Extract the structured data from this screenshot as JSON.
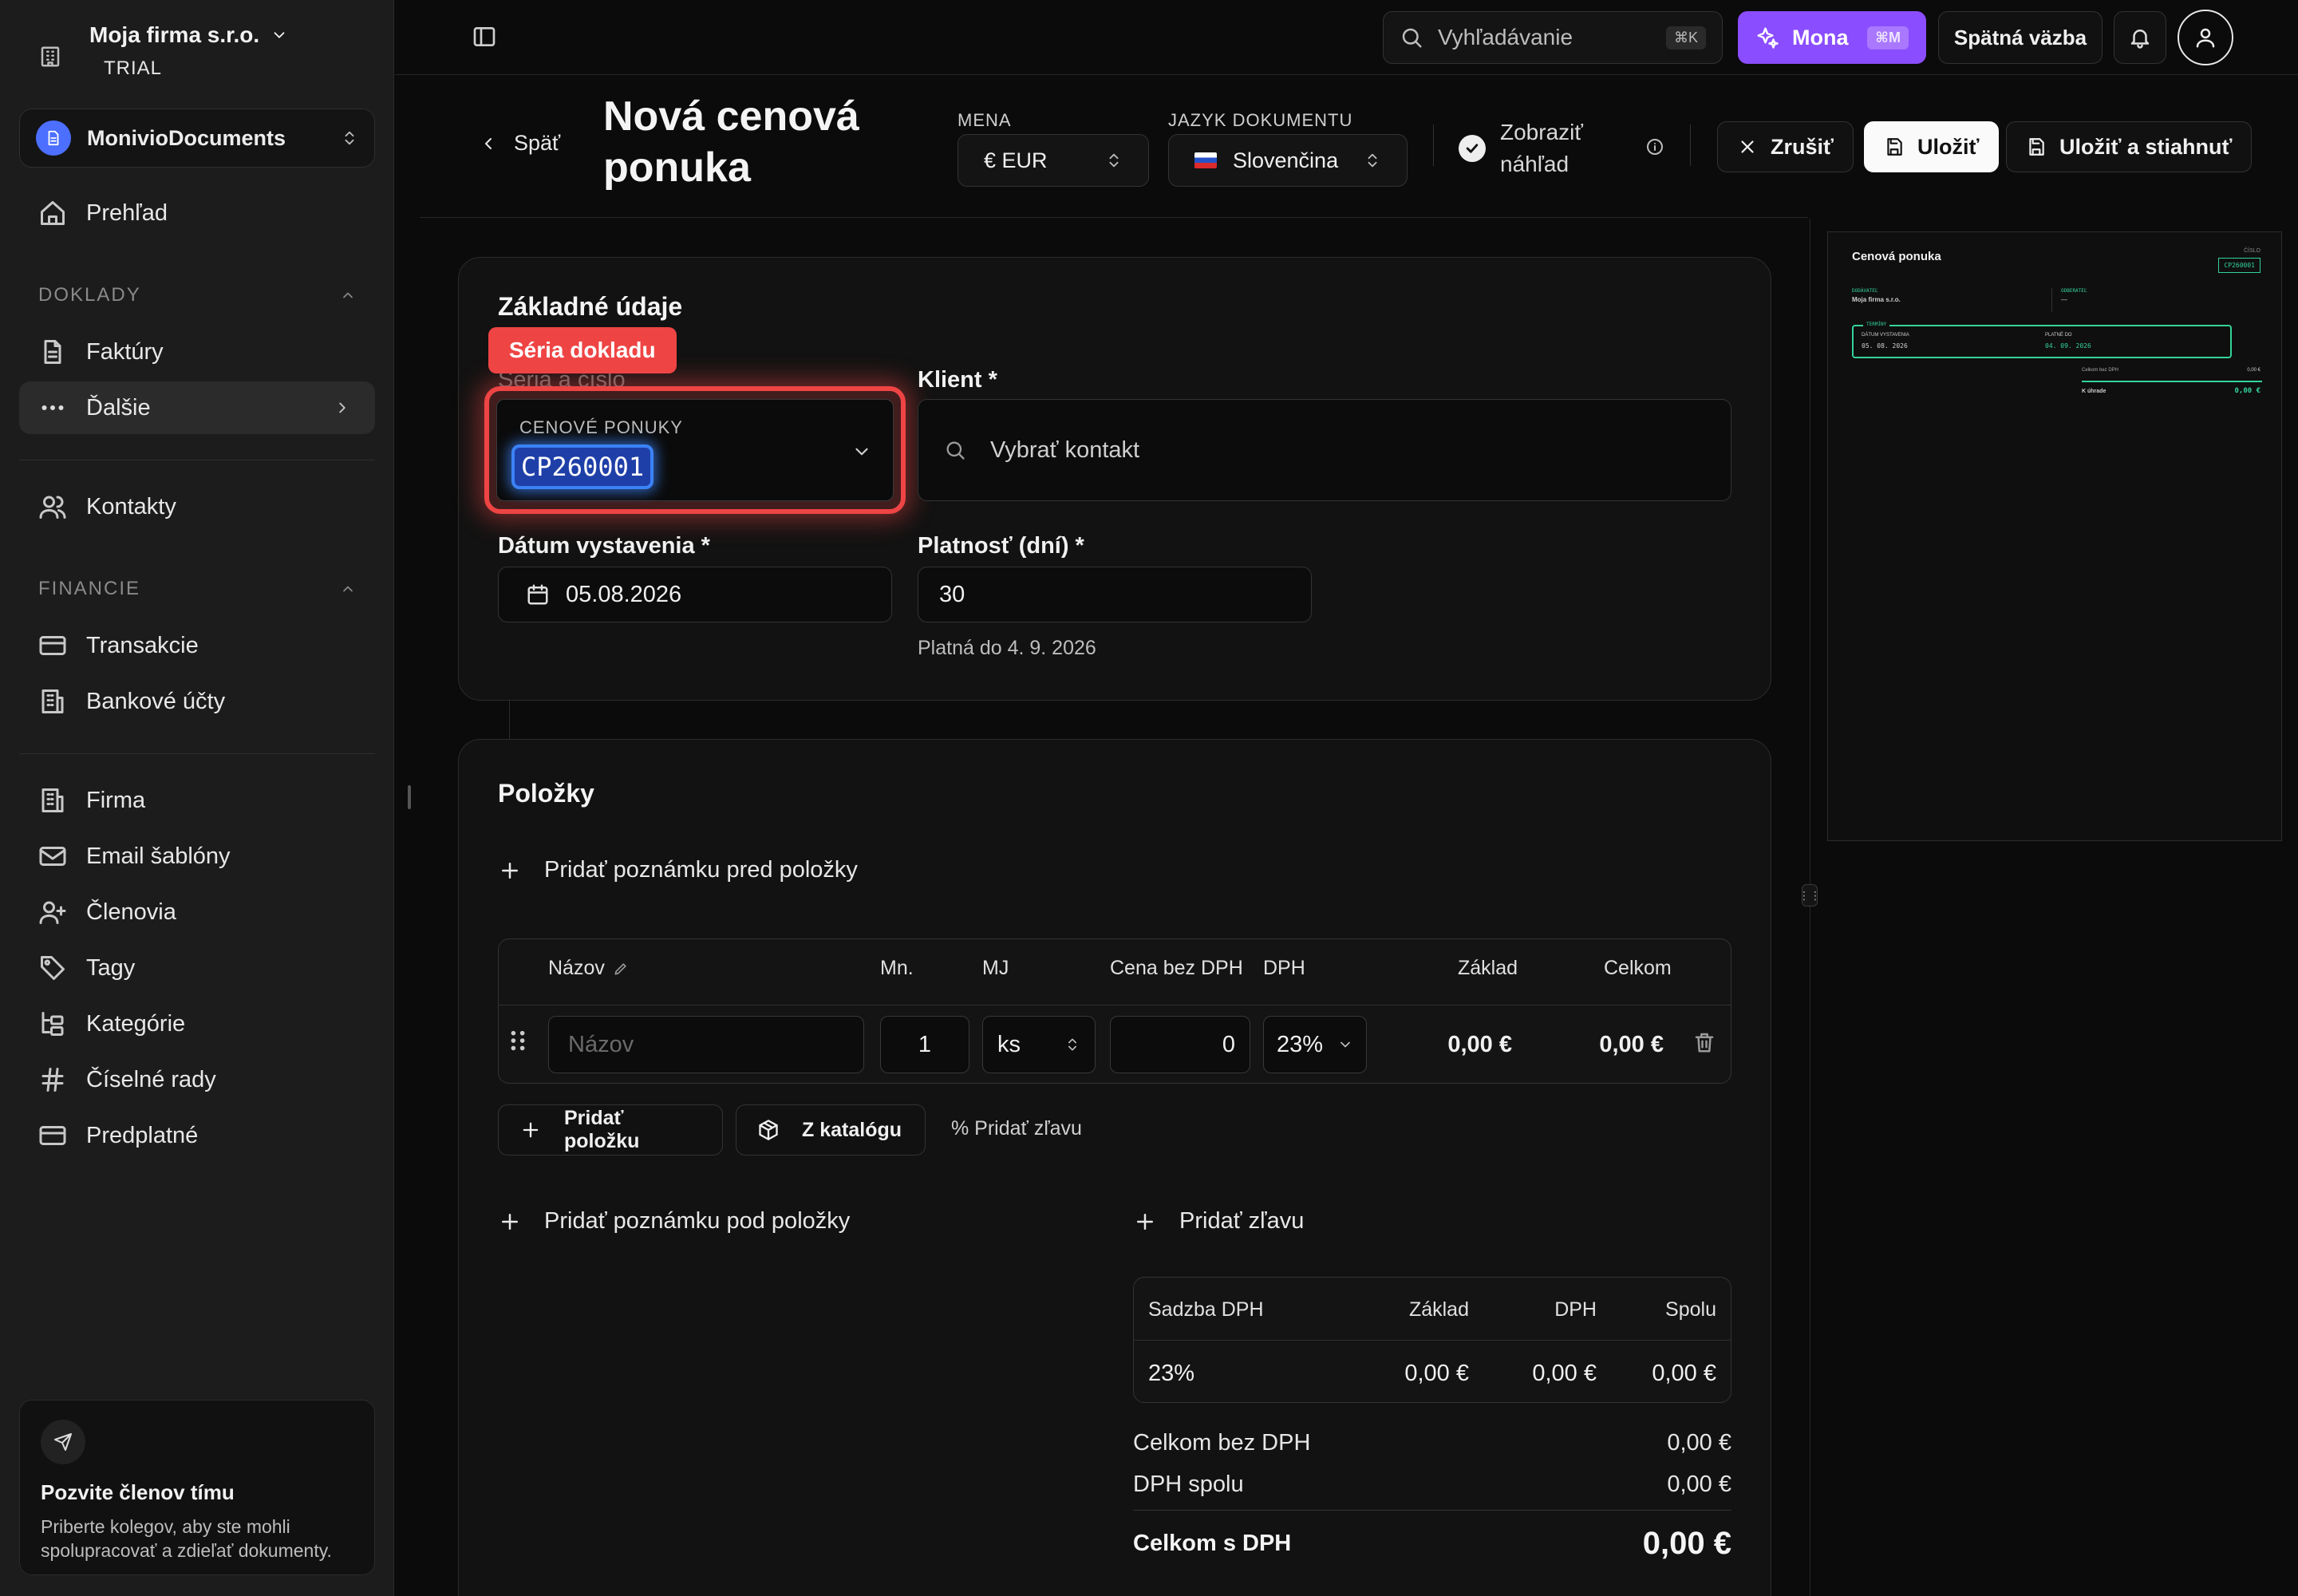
{
  "sidebar": {
    "org_name": "Moja firma s.r.o.",
    "org_plan": "TRIAL",
    "workspace": "MonivioDocuments",
    "nav_overview": "Prehľad",
    "section_doklady": "DOKLADY",
    "nav_invoices": "Faktúry",
    "nav_more": "Ďalšie",
    "nav_contacts": "Kontakty",
    "section_finance": "FINANCIE",
    "nav_transactions": "Transakcie",
    "nav_bank_accounts": "Bankové účty",
    "nav_company": "Firma",
    "nav_email_templates": "Email šablóny",
    "nav_members": "Členovia",
    "nav_tags": "Tagy",
    "nav_categories": "Kategórie",
    "nav_number_series": "Číselné rady",
    "nav_subscription": "Predplatné",
    "invite_title": "Pozvite členov tímu",
    "invite_text": "Priberte kolegov, aby ste mohli spolupracovať a zdieľať dokumenty."
  },
  "topbar": {
    "search_placeholder": "Vyhľadávanie",
    "search_shortcut": "⌘K",
    "mona_label": "Mona",
    "mona_shortcut": "⌘M",
    "feedback_label": "Spätná väzba"
  },
  "header": {
    "back_label": "Späť",
    "title": "Nová cenová ponuka",
    "currency_label": "MENA",
    "currency_value": "€ EUR",
    "language_label": "JAZYK DOKUMENTU",
    "language_value": "Slovenčina",
    "preview_label": "Zobraziť náhľad",
    "cancel_label": "Zrušiť",
    "save_label": "Uložiť",
    "save_download_label": "Uložiť a stiahnuť"
  },
  "basic": {
    "title": "Základné údaje",
    "highlight_tag": "Séria dokladu",
    "series_label": "Séria a číslo",
    "series_caption": "CENOVÉ PONUKY",
    "series_value": "CP260001",
    "client_label": "Klient *",
    "client_placeholder": "Vybrať kontakt",
    "issue_date_label": "Dátum vystavenia *",
    "issue_date_value": "05.08.2026",
    "validity_label": "Platnosť (dní) *",
    "validity_value": "30",
    "valid_until": "Platná do 4. 9. 2026"
  },
  "items": {
    "title": "Položky",
    "add_note_before": "Pridať poznámku pred položky",
    "columns": {
      "name": "Názov",
      "qty": "Mn.",
      "unit": "MJ",
      "price": "Cena bez DPH",
      "vat": "DPH",
      "base": "Základ",
      "total": "Celkom"
    },
    "row": {
      "name_placeholder": "Názov",
      "qty": "1",
      "unit": "ks",
      "price": "0",
      "vat": "23%",
      "base": "0,00 €",
      "total": "0,00 €"
    },
    "add_item": "Pridať položku",
    "from_catalog": "Z katalógu",
    "add_discount_small": "% Pridať zľavu",
    "add_note_after": "Pridať poznámku pod položky",
    "add_discount": "Pridať zľavu"
  },
  "vat_summary": {
    "columns": [
      "Sadzba DPH",
      "Základ",
      "DPH",
      "Spolu"
    ],
    "row": [
      "23%",
      "0,00 €",
      "0,00 €",
      "0,00 €"
    ]
  },
  "totals": {
    "net_label": "Celkom bez DPH",
    "net_value": "0,00 €",
    "vat_label": "DPH spolu",
    "vat_value": "0,00 €",
    "gross_label": "Celkom s DPH",
    "gross_value": "0,00 €"
  },
  "preview": {
    "doc_title": "Cenová ponuka",
    "number_caption": "ČÍSLO",
    "number": "CP260001",
    "supplier_caption": "DODÁVATEĽ",
    "supplier": "Moja firma s.r.o.",
    "customer_caption": "ODBERATEĽ",
    "customer": "—",
    "terms_caption": "TERMÍNY",
    "issue_caption": "DÁTUM VYSTAVENIA",
    "issue_value": "05. 08. 2026",
    "valid_caption": "PLATNÉ DO",
    "valid_value": "04. 09. 2026",
    "net_label": "Celkom bez DPH",
    "net_value": "0,00 €",
    "due_label": "K úhrade",
    "due_value": "0,00 €"
  },
  "colors": {
    "accent_purple": "#8a4dff",
    "highlight_red": "#ef4444",
    "focus_blue": "#3b82f6",
    "preview_green": "#34d399"
  }
}
